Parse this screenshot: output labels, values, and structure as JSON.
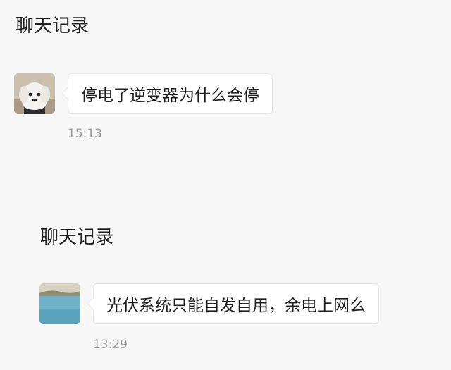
{
  "sections": [
    {
      "title": "聊天记录",
      "message": {
        "avatar": "dog-avatar-icon",
        "text": "停电了逆变器为什么会停",
        "time": "15:13"
      }
    },
    {
      "title": "聊天记录",
      "message": {
        "avatar": "lake-landscape-avatar-icon",
        "text": "光伏系统只能自发自用，余电上网么",
        "time": "13:29"
      }
    }
  ],
  "colors": {
    "background": "#f7f7f7",
    "bubble": "#ffffff",
    "bubble_border": "#e6e6e6",
    "timestamp": "#9a9a9a"
  }
}
